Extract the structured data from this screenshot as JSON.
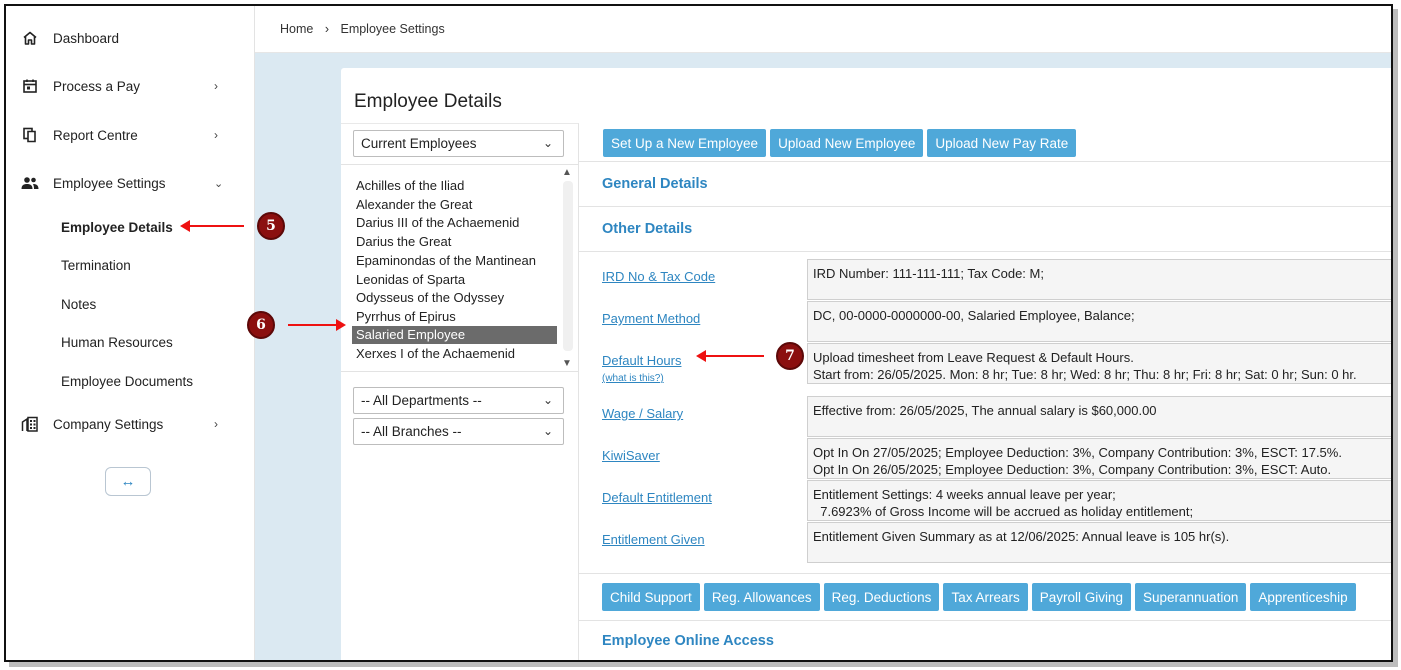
{
  "sidebar": {
    "items": [
      {
        "label": "Dashboard",
        "icon": "home-icon"
      },
      {
        "label": "Process a Pay",
        "icon": "calendar-icon"
      },
      {
        "label": "Report Centre",
        "icon": "documents-icon"
      },
      {
        "label": "Employee Settings",
        "icon": "users-icon"
      },
      {
        "label": "Company Settings",
        "icon": "building-icon"
      }
    ],
    "sub_items": [
      "Employee Details",
      "Termination",
      "Notes",
      "Human Resources",
      "Employee Documents"
    ],
    "toggle_label": "↔"
  },
  "breadcrumb": {
    "home": "Home",
    "current": "Employee Settings"
  },
  "panel": {
    "title": "Employee Details",
    "employee_filter": "Current Employees",
    "employees": [
      "Achilles of the Iliad",
      "Alexander the Great",
      "Darius III of the Achaemenid",
      "Darius the Great",
      "Epaminondas of the Mantinean",
      "Leonidas of Sparta",
      "Odysseus of the Odyssey",
      "Pyrrhus of Epirus",
      "Salaried Employee",
      "Xerxes I of the Achaemenid"
    ],
    "selected_employee": "Salaried Employee",
    "department_filter": "-- All Departments --",
    "branch_filter": "-- All Branches --"
  },
  "actions": {
    "setup": "Set Up a New Employee",
    "upload_employee": "Upload New Employee",
    "upload_pay_rate": "Upload New Pay Rate"
  },
  "sections": {
    "general": "General Details",
    "other": "Other Details",
    "online_access": "Employee Online Access"
  },
  "details": [
    {
      "label": "IRD No & Tax Code",
      "lines": [
        "IRD Number: 111-111-111; Tax Code: M;"
      ]
    },
    {
      "label": "Payment Method",
      "lines": [
        "DC, 00-0000-0000000-00, Salaried Employee, Balance;"
      ]
    },
    {
      "label": "Default Hours",
      "sub": "(what is this?)",
      "lines": [
        "Upload timesheet from Leave Request & Default Hours.",
        "Start from: 26/05/2025. Mon: 8 hr; Tue: 8 hr; Wed: 8 hr; Thu: 8 hr; Fri: 8 hr; Sat: 0 hr; Sun: 0 hr."
      ]
    },
    {
      "label": "Wage / Salary",
      "lines": [
        "Effective from: 26/05/2025,  The annual salary is $60,000.00"
      ]
    },
    {
      "label": "KiwiSaver",
      "lines": [
        "Opt In On 27/05/2025; Employee Deduction: 3%, Company Contribution: 3%, ESCT: 17.5%.",
        "Opt In On 26/05/2025; Employee Deduction: 3%, Company Contribution: 3%, ESCT: Auto."
      ]
    },
    {
      "label": "Default Entitlement",
      "lines": [
        "Entitlement Settings:   4 weeks annual leave per year;",
        "  7.6923% of Gross Income will be accrued as holiday entitlement;"
      ]
    },
    {
      "label": "Entitlement Given",
      "lines": [
        "Entitlement Given Summary as at 12/06/2025:   Annual leave is 105 hr(s)."
      ]
    }
  ],
  "bottom_buttons": [
    "Child Support",
    "Reg. Allowances",
    "Reg. Deductions",
    "Tax Arrears",
    "Payroll Giving",
    "Superannuation",
    "Apprenticeship"
  ],
  "annotations": [
    "5",
    "6",
    "7"
  ],
  "colors": {
    "accent": "#2e86c1",
    "button": "#4fa8d9",
    "annotation": "#e11111",
    "badge": "#8b0f0f",
    "background": "#dbe9f2"
  }
}
